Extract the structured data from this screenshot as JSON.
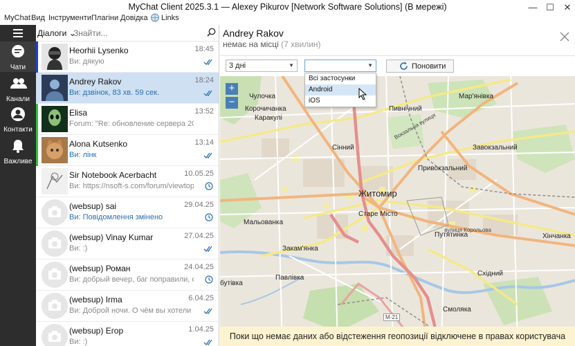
{
  "window": {
    "title": "MyChat Client 2025.3.1 — Alexey Pikurov [Network Software Solutions] (В мережі)"
  },
  "menu": [
    "MyChat",
    "Вид",
    "Інструменти",
    "Плагіни",
    "Довідка",
    "Links"
  ],
  "nav": [
    {
      "label": "Чати",
      "icon": "chat-bubble-icon"
    },
    {
      "label": "Канали",
      "icon": "people-icon"
    },
    {
      "label": "Контакти",
      "icon": "person-icon"
    },
    {
      "label": "Важливе",
      "icon": "bell-icon"
    }
  ],
  "search": {
    "filter": "Діалоги",
    "placeholder": "Знайти..."
  },
  "conversations": [
    {
      "name": "Heorhii Lysenko",
      "message": "Ви: дякую",
      "time": "18:45",
      "status": "read",
      "bar": "#1f3fd6"
    },
    {
      "name": "Andrey Rakov",
      "message": "Ви: дзвінок, 83 хв. 59 сек.",
      "time": "18:24",
      "status": "read",
      "bar": "",
      "msg_blue": true
    },
    {
      "name": "Elisa",
      "message": "Forum: \"Re: обновление сервера 20...",
      "time": "13:52",
      "status": "",
      "bar": "#2fc23a"
    },
    {
      "name": "Alona Kutsenko",
      "message": "Ви: лінк",
      "time": "13:14",
      "status": "read",
      "bar": "#2fc23a",
      "msg_blue": true
    },
    {
      "name": "Sir Notebook Acerbacht",
      "message": "Ви: https://nsoft-s.com/forum/viewtopic...",
      "time": "10.05.25",
      "status": "pending",
      "bar": ""
    },
    {
      "name": "(websup) sai",
      "message": "Ви: Повідомлення змінено",
      "time": "29.04.25",
      "status": "pending",
      "bar": "",
      "msg_blue": true
    },
    {
      "name": "(websup) Vinay Kumar",
      "message": "Ви: :)",
      "time": "27.04.25",
      "status": "read",
      "bar": ""
    },
    {
      "name": "(websup) Роман",
      "message": "Ви: добрый вечер, баг поправили, об...",
      "time": "24.04.25",
      "status": "pending",
      "bar": ""
    },
    {
      "name": "(websup) Irma",
      "message": "Ви: Доброй ночи. О чём вы хотели сп...",
      "time": "6.04.25",
      "status": "read",
      "bar": ""
    },
    {
      "name": "(websup) Егор",
      "message": "Ви: :)",
      "time": "1.04.25",
      "status": "read",
      "bar": ""
    }
  ],
  "contact": {
    "name": "Andrey Rakov",
    "status": "немає на місці",
    "ago": "(7 хвилин)"
  },
  "controls": {
    "period": "3 дні",
    "app_filter": "",
    "refresh": "Поновити"
  },
  "dropdown_options": [
    "Всі застосунки",
    "Android",
    "iOS"
  ],
  "map": {
    "labels": [
      "Чулочка",
      "Корочичанка",
      "Каракулі",
      "Пивнічний",
      "Мар'янівка",
      "Завокзальний",
      "Сінний",
      "Привокзальний",
      "Житомир",
      "Старе Місто",
      "Мальованка",
      "Путятинка",
      "Закам'янка",
      "Хінчанка",
      "Павлівка",
      "бутівка",
      "Східний",
      "Смоляка",
      "Вокзальна вулиця",
      "вулиця Корольова",
      "М-21"
    ],
    "zoom_in": "+",
    "zoom_out": "−"
  },
  "banner": "Поки що немає даних або відстеження геопозиції відключене в правах користувача"
}
